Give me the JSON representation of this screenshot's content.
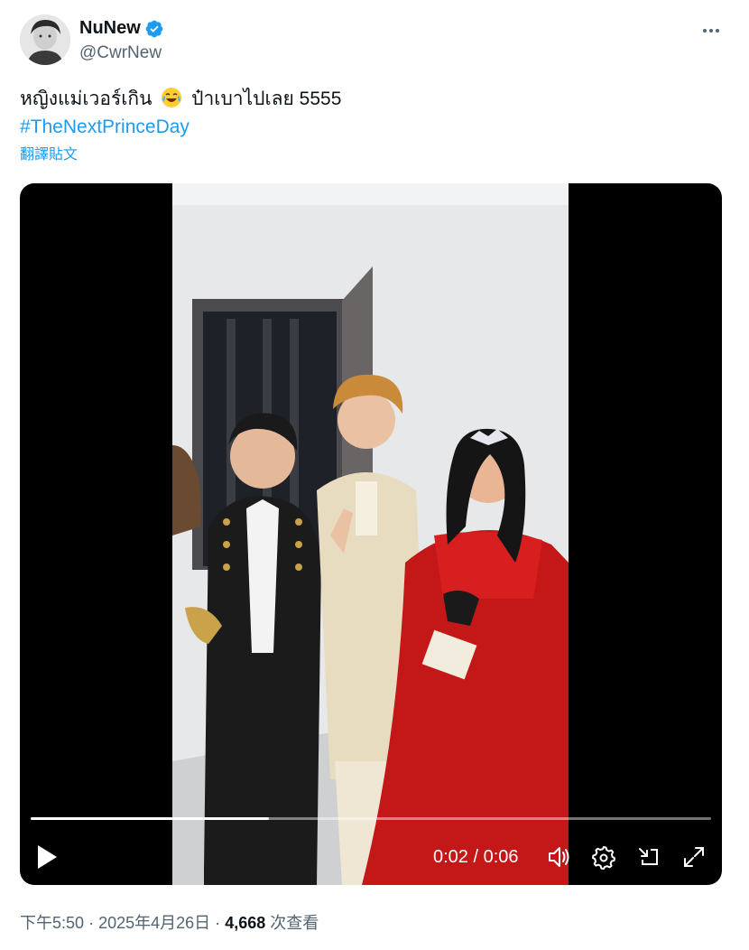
{
  "author": {
    "display_name": "NuNew",
    "handle": "@CwrNew",
    "verified": true,
    "verified_color": "#1d9bf0"
  },
  "tweet": {
    "text_before_emoji": "หญิงแม่เวอร์เกิน",
    "emoji": "face-with-tears-of-joy",
    "text_after_emoji": "ป๋าเบาไปเลย 5555",
    "hashtag": "#TheNextPrinceDay",
    "translate_label": "翻譯貼文"
  },
  "video": {
    "current_time": "0:02",
    "separator": "/",
    "duration": "0:06",
    "progress_fraction": 0.35
  },
  "meta": {
    "time": "下午5:50",
    "dot1": "·",
    "date": "2025年4月26日",
    "dot2": "·",
    "views_count": "4,668",
    "views_label": "次查看"
  },
  "colors": {
    "accent": "#1d9bf0",
    "text_primary": "#0f1419",
    "text_secondary": "#536471"
  }
}
